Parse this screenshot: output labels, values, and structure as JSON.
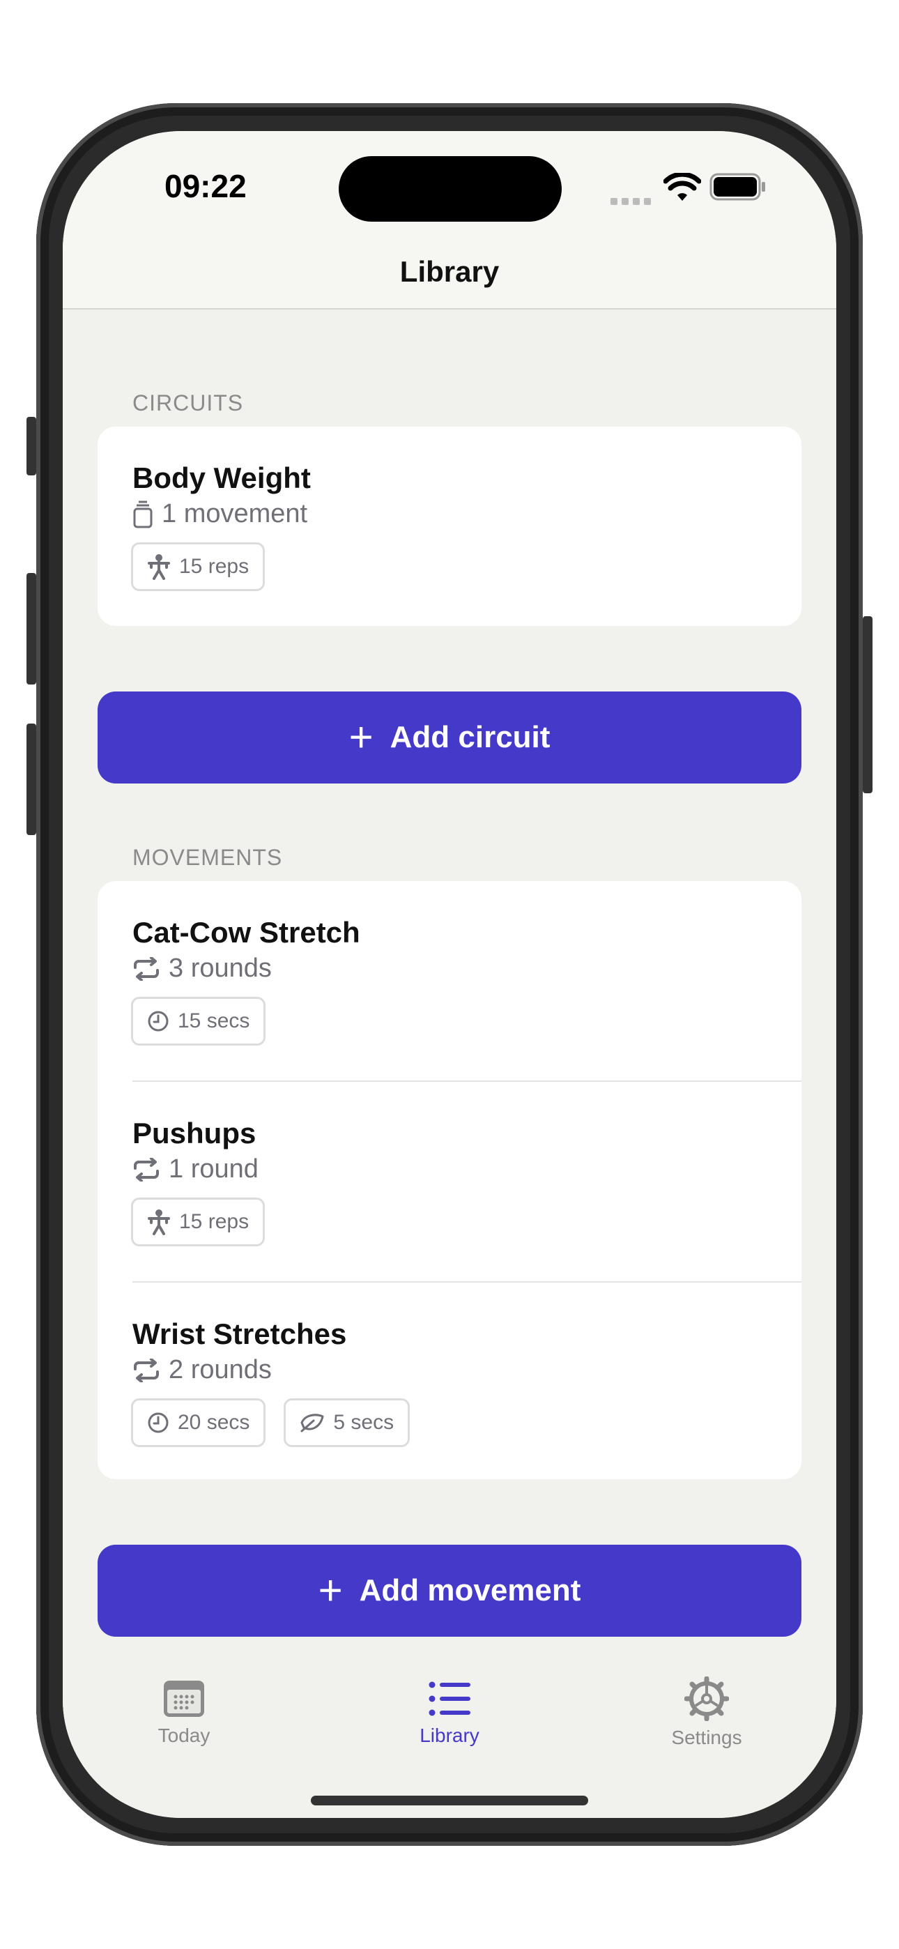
{
  "status": {
    "time": "09:22"
  },
  "nav": {
    "title": "Library"
  },
  "circuits": {
    "section_label": "CIRCUITS",
    "items": [
      {
        "title": "Body Weight",
        "subtitle": "1 movement",
        "chips": [
          {
            "icon": "figure-icon",
            "label": "15 reps"
          }
        ]
      }
    ],
    "add_label": "Add circuit"
  },
  "movements": {
    "section_label": "MOVEMENTS",
    "items": [
      {
        "title": "Cat-Cow Stretch",
        "subtitle": "3 rounds",
        "chips": [
          {
            "icon": "clock-icon",
            "label": "15 secs"
          }
        ]
      },
      {
        "title": "Pushups",
        "subtitle": "1 round",
        "chips": [
          {
            "icon": "figure-icon",
            "label": "15 reps"
          }
        ]
      },
      {
        "title": "Wrist Stretches",
        "subtitle": "2 rounds",
        "chips": [
          {
            "icon": "clock-icon",
            "label": "20 secs"
          },
          {
            "icon": "leaf-icon",
            "label": "5 secs"
          }
        ]
      }
    ],
    "add_label": "Add movement"
  },
  "tabs": [
    {
      "label": "Today",
      "icon": "calendar-icon",
      "active": false
    },
    {
      "label": "Library",
      "icon": "list-icon",
      "active": true
    },
    {
      "label": "Settings",
      "icon": "gear-icon",
      "active": false
    }
  ],
  "colors": {
    "accent": "#4439c9",
    "background": "#f1f1ee",
    "inactive_tab": "#8a8a8a"
  }
}
